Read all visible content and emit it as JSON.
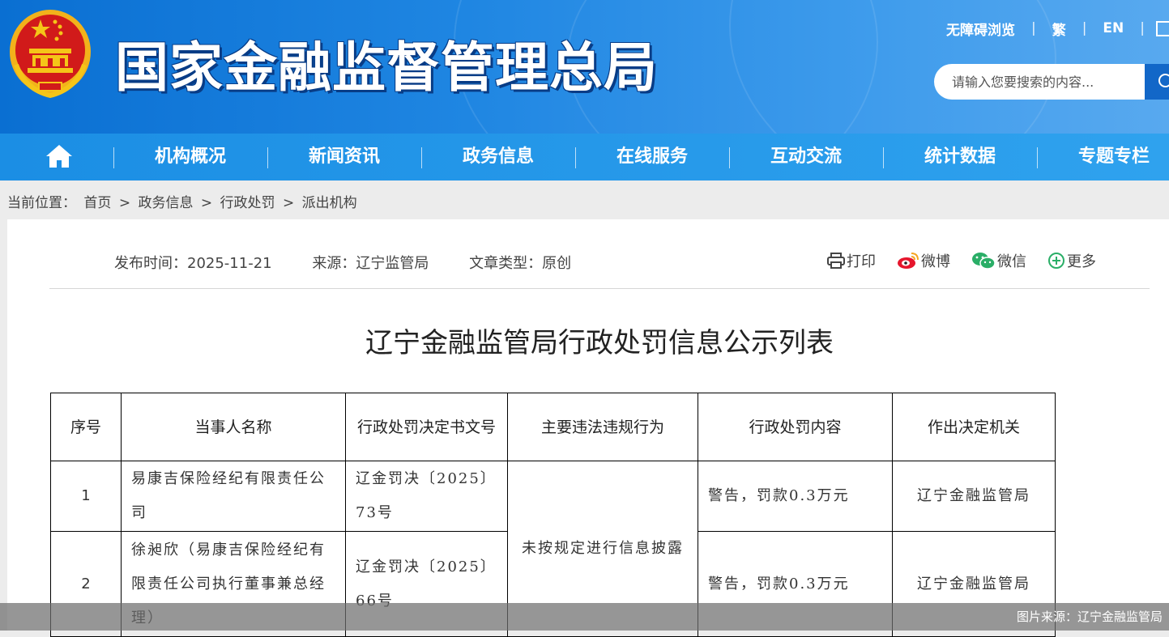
{
  "header": {
    "site_title": "国家金融监督管理总局",
    "top_links": [
      "无障碍浏览",
      "繁",
      "EN"
    ],
    "search_placeholder": "请输入您要搜索的内容..."
  },
  "nav": {
    "items": [
      "机构概况",
      "新闻资讯",
      "政务信息",
      "在线服务",
      "互动交流",
      "统计数据",
      "专题专栏"
    ]
  },
  "breadcrumb": {
    "label": "当前位置：",
    "items": [
      "首页",
      "政务信息",
      "行政处罚",
      "派出机构"
    ],
    "separator": ">"
  },
  "article": {
    "publish_time": "发布时间：2025-11-21",
    "source": "来源：辽宁监管局",
    "type": "文章类型：原创",
    "share": [
      "打印",
      "微博",
      "微信",
      "更多"
    ],
    "title": "辽宁金融监管局行政处罚信息公示列表"
  },
  "table": {
    "headers": [
      "序号",
      "当事人名称",
      "行政处罚决定书文号",
      "主要违法违规行为",
      "行政处罚内容",
      "作出决定机关"
    ],
    "rows": [
      {
        "index": "1",
        "party": "易康吉保险经纪有限责任公司",
        "doc_no": "辽金罚决〔2025〕73号",
        "content": "警告，罚款0.3万元",
        "authority": "辽宁金融监管局"
      },
      {
        "index": "2",
        "party": "徐昶欣（易康吉保险经纪有限责任公司执行董事兼总经理）",
        "doc_no": "辽金罚决〔2025〕66号",
        "content": "警告，罚款0.3万元",
        "authority": "辽宁金融监管局"
      }
    ],
    "violation_merged": "未按规定进行信息披露"
  },
  "caption": "图片来源：辽宁金融监管局",
  "colors": {
    "header_blue": "#1f86e2",
    "nav_blue": "#2fa2ee",
    "emblem_red": "#d11a1a",
    "emblem_gold": "#f5c518",
    "weibo_red": "#e6162d",
    "wechat_green": "#2aae67"
  }
}
